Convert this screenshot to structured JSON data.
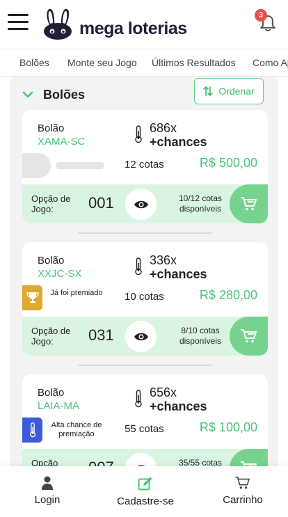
{
  "header": {
    "logo_text": "mega loterias",
    "notification_count": "3"
  },
  "nav": {
    "items": [
      "Bolões",
      "Monte seu Jogo",
      "Últimos Resultados",
      "Como Ap"
    ]
  },
  "section": {
    "title": "Bolões",
    "sort_label": "Ordenar"
  },
  "cards": [
    {
      "label": "Bolão",
      "code": "XAMA-SC",
      "multiplier": "686x",
      "chances": "+chances",
      "tag": "",
      "cotas": "12 cotas",
      "price": "R$ 500,00",
      "option_label": "Opção de Jogo:",
      "option_number": "001",
      "available": "10/12 cotas disponíveis"
    },
    {
      "label": "Bolão",
      "code": "XXJC-SX",
      "multiplier": "336x",
      "chances": "+chances",
      "tag": "Já foi premiado",
      "tag_color": "#e0a92c",
      "cotas": "10 cotas",
      "price": "R$ 280,00",
      "option_label": "Opção de Jogo:",
      "option_number": "031",
      "available": "8/10 cotas disponíveis"
    },
    {
      "label": "Bolão",
      "code": "LAIA-MA",
      "multiplier": "656x",
      "chances": "+chances",
      "tag": "Alta chance de premiação",
      "tag_color": "#3d5bd9",
      "cotas": "55 cotas",
      "price": "R$ 100,00",
      "option_label": "Opção",
      "option_number": "007",
      "available": "35/55 cotas"
    }
  ],
  "bottom_nav": {
    "login": "Login",
    "signup": "Cadastre-se",
    "cart": "Carrinho"
  },
  "colors": {
    "accent_green": "#49c57a",
    "light_green": "#d9f5e1",
    "cart_green": "#76d38e",
    "badge_red": "#ef4b4b"
  },
  "icons": [
    "menu-icon",
    "bunny-logo-icon",
    "bell-icon",
    "chevron-down-icon",
    "sort-icon",
    "thermometer-icon",
    "trophy-icon",
    "eye-icon",
    "cart-icon",
    "user-icon",
    "edit-icon"
  ]
}
